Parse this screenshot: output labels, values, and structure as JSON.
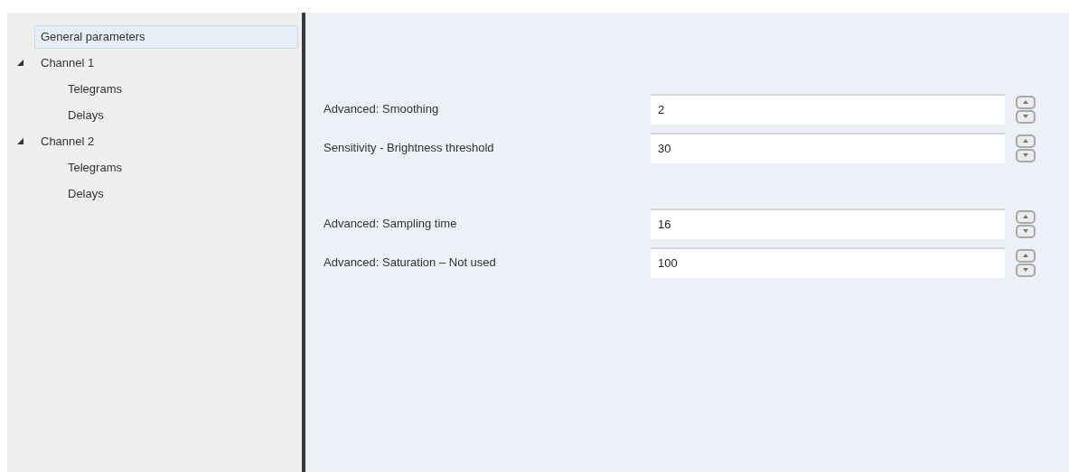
{
  "tree": [
    {
      "label": "General parameters",
      "selected": true
    },
    {
      "label": "Channel 1",
      "selected": false,
      "expanded": true,
      "children": [
        {
          "label": "Telegrams",
          "selected": false
        },
        {
          "label": "Delays",
          "selected": false
        }
      ]
    },
    {
      "label": "Channel 2",
      "selected": false,
      "expanded": true,
      "children": [
        {
          "label": "Telegrams",
          "selected": false
        },
        {
          "label": "Delays",
          "selected": false
        }
      ]
    }
  ],
  "parameter_groups": [
    [
      {
        "label": "Advanced: Smoothing",
        "value": "2"
      },
      {
        "label": "Sensitivity - Brightness threshold",
        "value": "30"
      }
    ],
    [
      {
        "label": "Advanced: Sampling time",
        "value": "16"
      },
      {
        "label": "Advanced: Saturation  – Not used",
        "value": "100"
      }
    ]
  ]
}
